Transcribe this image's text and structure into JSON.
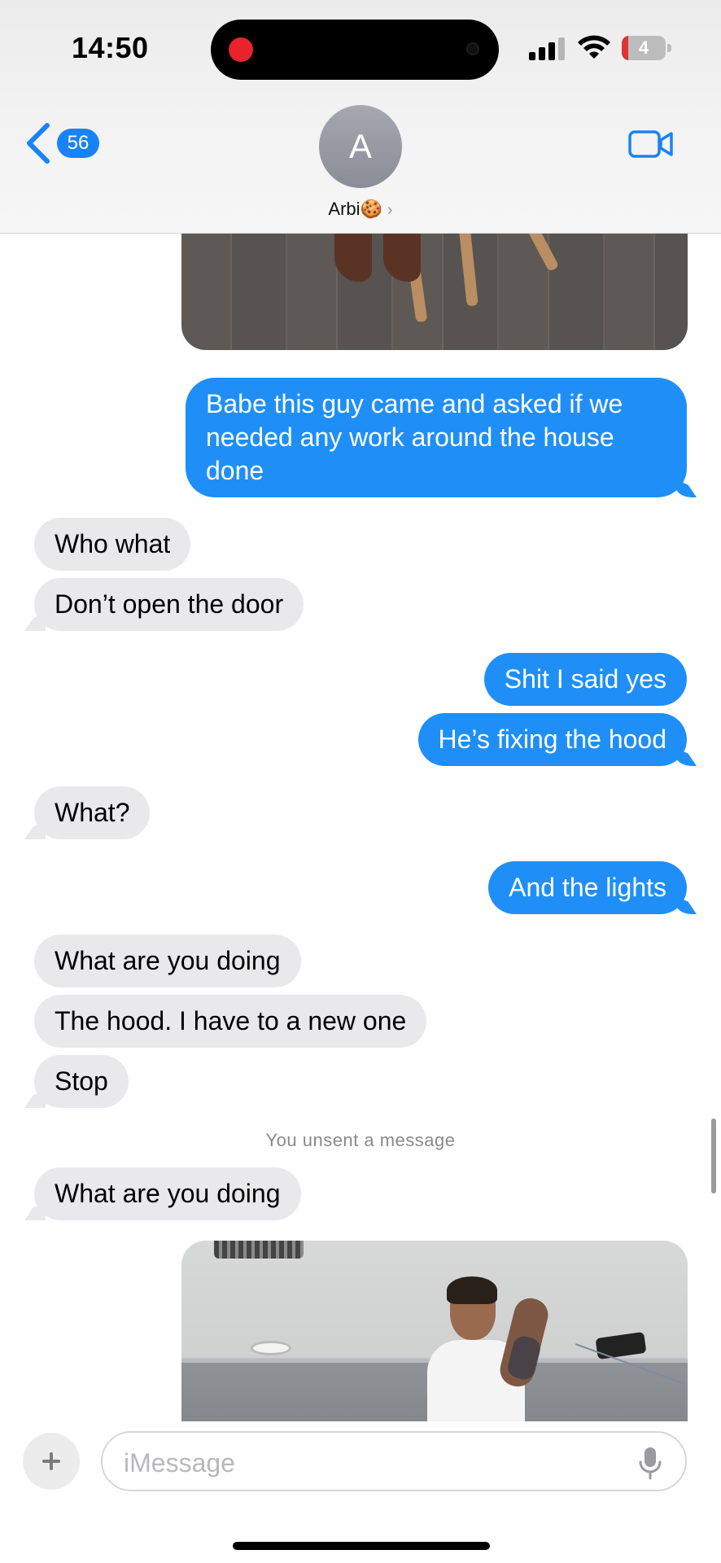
{
  "status_bar": {
    "time": "14:50",
    "battery": "4",
    "battery_level": 0.04
  },
  "header": {
    "back_badge": "56",
    "avatar_initial": "A",
    "contact_name": "Arbi🍪",
    "icons": [
      "chevron-left-icon",
      "video-camera-icon"
    ]
  },
  "messages": [
    {
      "type": "image",
      "direction": "out"
    },
    {
      "type": "text",
      "direction": "out",
      "text": "Babe this guy came and asked if we needed any work around the house done"
    },
    {
      "type": "text",
      "direction": "in",
      "text": "Who what"
    },
    {
      "type": "text",
      "direction": "in",
      "text": "Don’t open the door"
    },
    {
      "type": "text",
      "direction": "out",
      "text": "Shit I said yes"
    },
    {
      "type": "text",
      "direction": "out",
      "text": "He’s fixing the hood"
    },
    {
      "type": "text",
      "direction": "in",
      "text": "What?"
    },
    {
      "type": "text",
      "direction": "out",
      "text": "And the lights"
    },
    {
      "type": "text",
      "direction": "in",
      "text": "What are you doing"
    },
    {
      "type": "text",
      "direction": "in",
      "text": "The hood. I have to a new one"
    },
    {
      "type": "text",
      "direction": "in",
      "text": "Stop"
    },
    {
      "type": "system",
      "text": "You unsent a message"
    },
    {
      "type": "text",
      "direction": "in",
      "text": "What are you doing"
    },
    {
      "type": "image",
      "direction": "out"
    }
  ],
  "composer": {
    "placeholder": "iMessage"
  },
  "colors": {
    "outgoing": "#1f8ff7",
    "incoming": "#e9e9eb",
    "accent": "#1a82f7"
  }
}
